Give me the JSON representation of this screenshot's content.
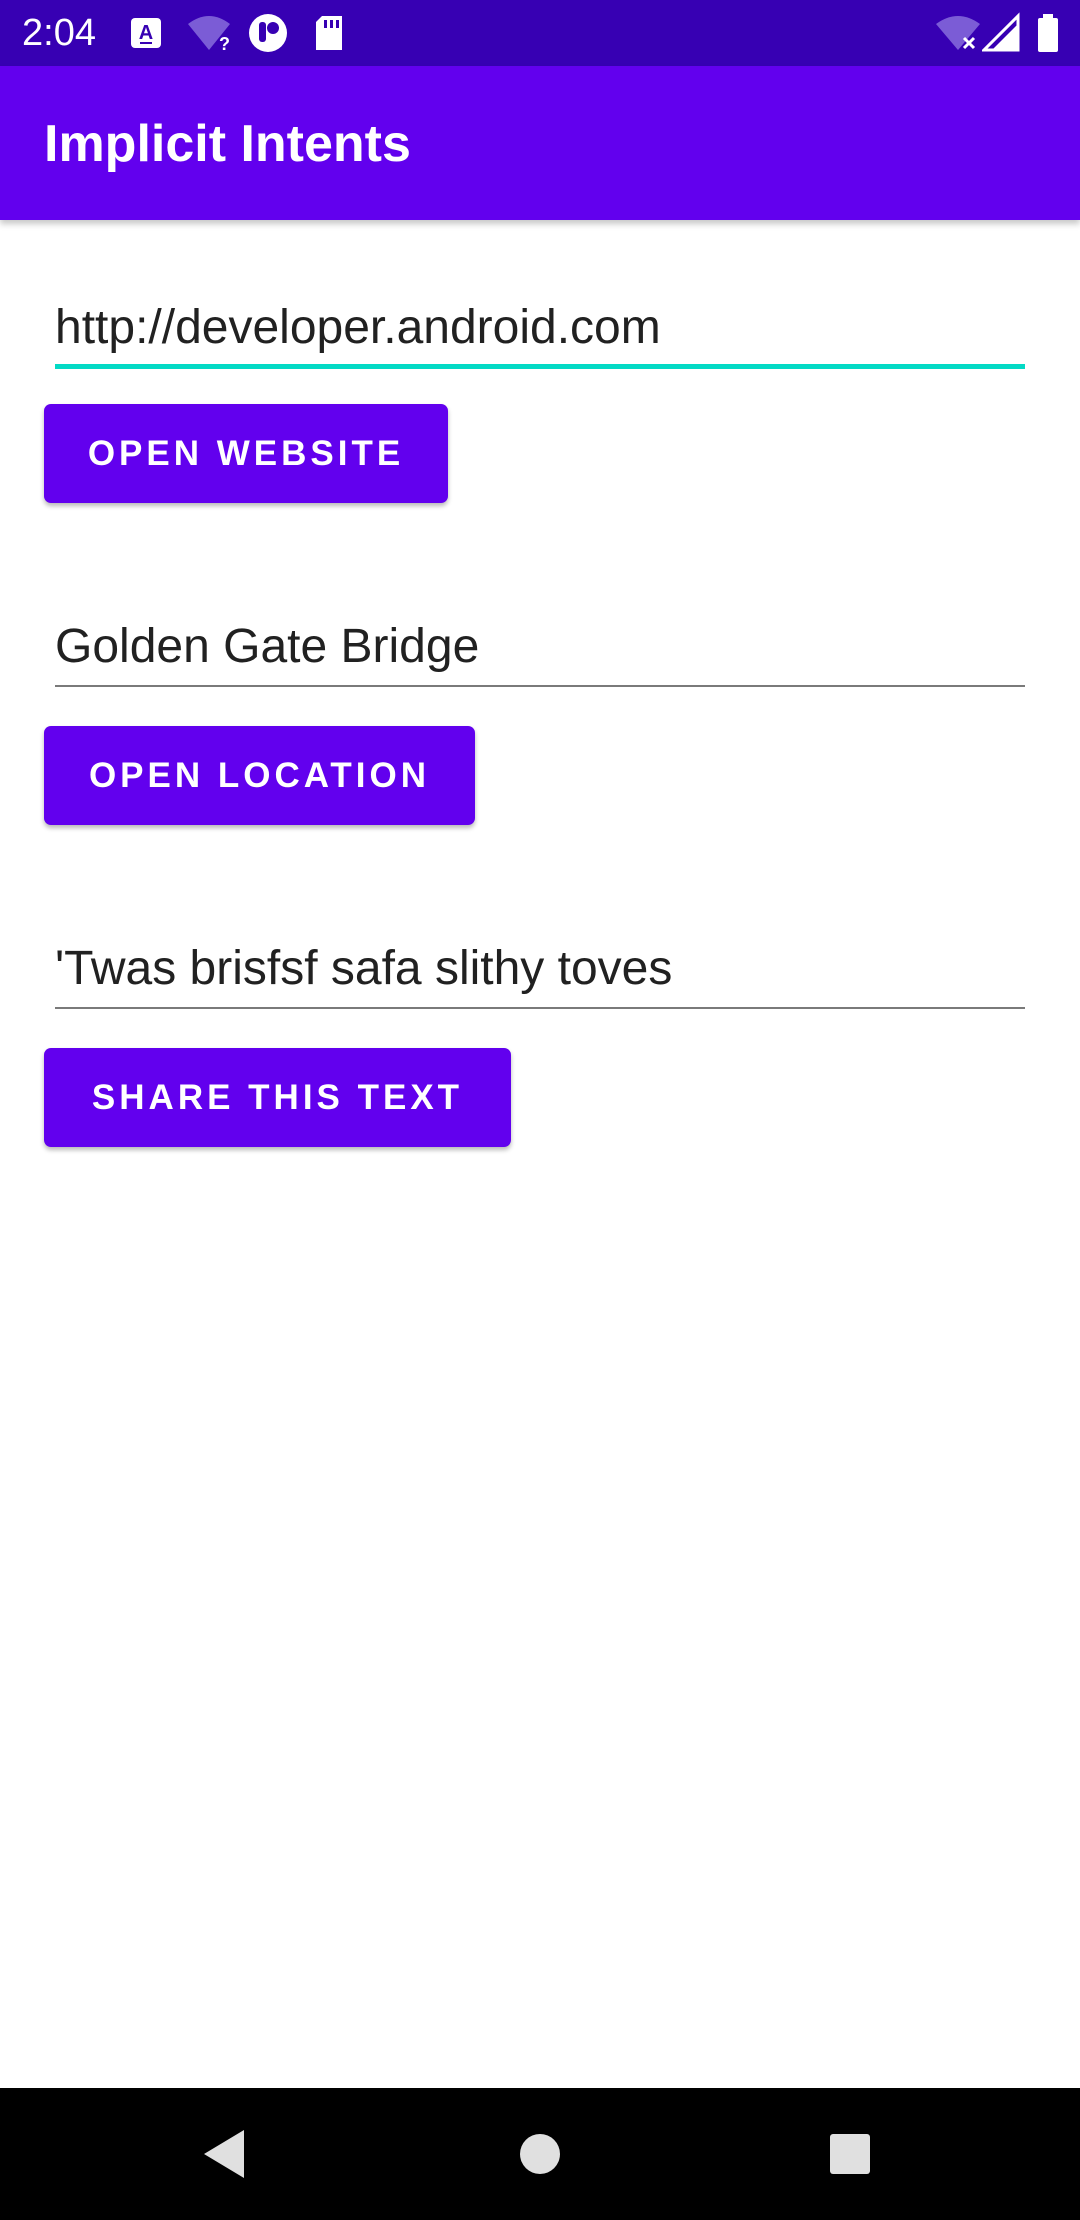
{
  "status_bar": {
    "time": "2:04",
    "left_icons": [
      "keyboard-icon",
      "wifi-question-icon",
      "notification-app-icon",
      "sd-card-icon"
    ],
    "right_icons": [
      "wifi-off-icon",
      "cell-signal-icon",
      "battery-icon"
    ]
  },
  "app_bar": {
    "title": "Implicit Intents"
  },
  "website": {
    "value": "http://developer.android.com",
    "button_label": "OPEN WEBSITE"
  },
  "location": {
    "value": "Golden Gate Bridge",
    "button_label": "OPEN LOCATION"
  },
  "share": {
    "value": "'Twas brisfsf safa slithy toves",
    "button_label": "SHARE THIS TEXT"
  },
  "nav_bar": {
    "icons": [
      "back-icon",
      "home-icon",
      "recents-icon"
    ]
  },
  "colors": {
    "primary": "#6200ee",
    "primary_dark": "#3700b3",
    "accent": "#03dac5"
  }
}
